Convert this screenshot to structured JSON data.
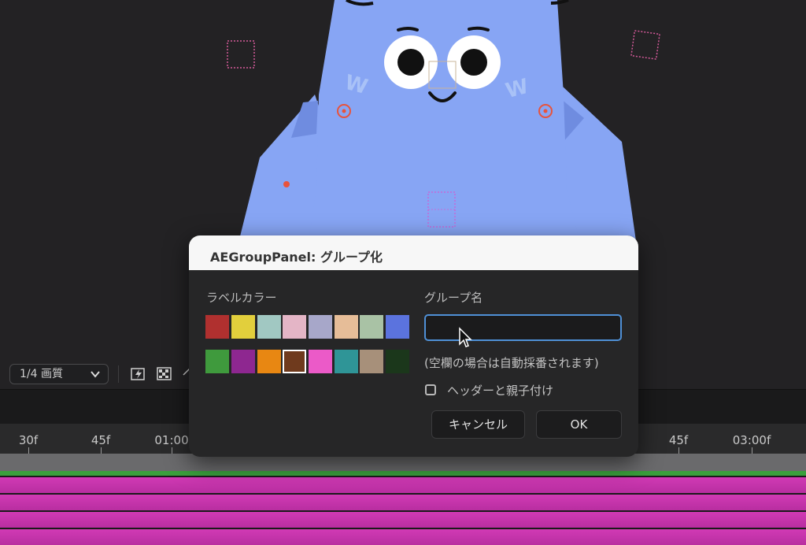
{
  "viewer": {
    "quality_select": "1/4 画質",
    "icons": [
      "chevron-down-icon",
      "fast-preview-icon",
      "transparency-grid-icon",
      "region-of-interest-icon"
    ]
  },
  "timeline": {
    "ticks": [
      {
        "label": "30f"
      },
      {
        "label": "45f"
      },
      {
        "label": "01:00"
      },
      {
        "label": "45f"
      },
      {
        "label": "03:00f"
      }
    ]
  },
  "dialog": {
    "title": "AEGroupPanel: グループ化",
    "label_color_heading": "ラベルカラー",
    "group_name_heading": "グループ名",
    "group_name_value": "",
    "hint": "(空欄の場合は自動採番されます)",
    "parent_checkbox_label": "ヘッダーと親子付け",
    "parent_checkbox_checked": false,
    "cancel_label": "キャンセル",
    "ok_label": "OK",
    "swatches_row1": [
      "#b0302f",
      "#e2cf3c",
      "#a1c8c2",
      "#e4b5c6",
      "#a7a7c9",
      "#e6bd98",
      "#a9c2a5",
      "#5b73de"
    ],
    "swatches_row2": [
      "#3f9a3d",
      "#8e2790",
      "#e88712",
      "#6f3a1d",
      "#eb5ac8",
      "#2f9597",
      "#a7907a",
      "#1b371b"
    ],
    "selected_swatch": "row2-4"
  },
  "colors": {
    "accent": "#4f90d6",
    "character": "#87a5f4",
    "track": "#d13ab5"
  }
}
